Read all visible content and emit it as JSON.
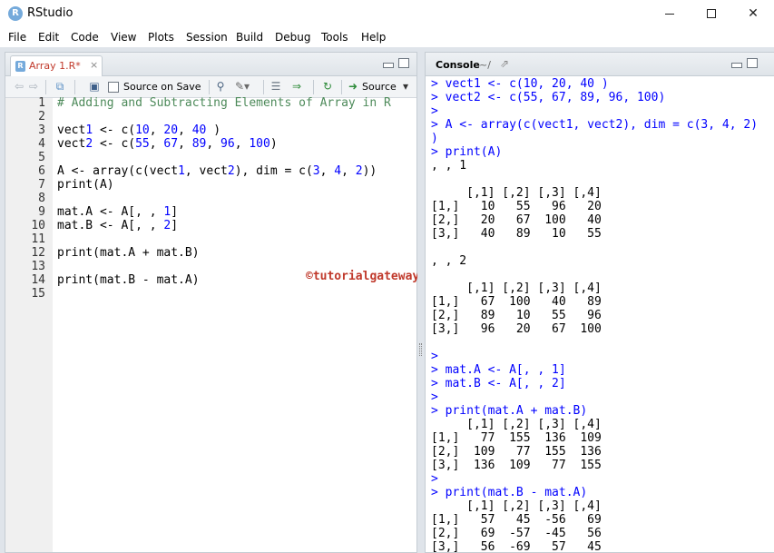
{
  "window": {
    "logo": "R",
    "title": "RStudio",
    "minimize": "",
    "maximize": "",
    "close": "✕"
  },
  "menu": [
    "File",
    "Edit",
    "Code",
    "View",
    "Plots",
    "Session",
    "Build",
    "Debug",
    "Tools",
    "Help"
  ],
  "editor": {
    "tab_label": "Array 1.R*",
    "tab_close": "×",
    "source_on_save": "Source on Save",
    "source_button": "Source",
    "icons": [
      "back-arrow-icon",
      "forward-arrow-icon",
      "show-in-window-icon",
      "save-icon",
      "search-icon",
      "code-tools-wand-icon",
      "compile-report-icon",
      "run-line-icon",
      "rerun-icon",
      "source-icon"
    ],
    "line_numbers": [
      "1",
      "2",
      "3",
      "4",
      "5",
      "6",
      "7",
      "8",
      "9",
      "10",
      "11",
      "12",
      "13",
      "14",
      "15"
    ],
    "lines": [
      "# Adding and Subtracting Elements of Array in R",
      "",
      "vect1 <- c(10, 20, 40 )",
      "vect2 <- c(55, 67, 89, 96, 100)",
      "",
      "A <- array(c(vect1, vect2), dim = c(3, 4, 2))",
      "print(A)",
      "",
      "mat.A <- A[, , 1]",
      "mat.B <- A[, , 2]",
      "",
      "print(mat.A + mat.B)",
      "",
      "print(mat.B - mat.A)",
      ""
    ],
    "watermark": "©tutorialgateway.org"
  },
  "console": {
    "tab_label": "Console",
    "path": "~/",
    "lines": [
      {
        "kind": "in",
        "text": "> vect1 <- c(10, 20, 40 )"
      },
      {
        "kind": "in",
        "text": "> vect2 <- c(55, 67, 89, 96, 100)"
      },
      {
        "kind": "in",
        "text": ">"
      },
      {
        "kind": "in",
        "text": "> A <- array(c(vect1, vect2), dim = c(3, 4, 2)"
      },
      {
        "kind": "in",
        "text": ")"
      },
      {
        "kind": "in",
        "text": "> print(A)"
      },
      {
        "kind": "out",
        "text": ", , 1"
      },
      {
        "kind": "out",
        "text": ""
      },
      {
        "kind": "out",
        "text": "     [,1] [,2] [,3] [,4]"
      },
      {
        "kind": "out",
        "text": "[1,]   10   55   96   20"
      },
      {
        "kind": "out",
        "text": "[2,]   20   67  100   40"
      },
      {
        "kind": "out",
        "text": "[3,]   40   89   10   55"
      },
      {
        "kind": "out",
        "text": ""
      },
      {
        "kind": "out",
        "text": ", , 2"
      },
      {
        "kind": "out",
        "text": ""
      },
      {
        "kind": "out",
        "text": "     [,1] [,2] [,3] [,4]"
      },
      {
        "kind": "out",
        "text": "[1,]   67  100   40   89"
      },
      {
        "kind": "out",
        "text": "[2,]   89   10   55   96"
      },
      {
        "kind": "out",
        "text": "[3,]   96   20   67  100"
      },
      {
        "kind": "out",
        "text": ""
      },
      {
        "kind": "in",
        "text": ">"
      },
      {
        "kind": "in",
        "text": "> mat.A <- A[, , 1]"
      },
      {
        "kind": "in",
        "text": "> mat.B <- A[, , 2]"
      },
      {
        "kind": "in",
        "text": ">"
      },
      {
        "kind": "in",
        "text": "> print(mat.A + mat.B)"
      },
      {
        "kind": "out",
        "text": "     [,1] [,2] [,3] [,4]"
      },
      {
        "kind": "out",
        "text": "[1,]   77  155  136  109"
      },
      {
        "kind": "out",
        "text": "[2,]  109   77  155  136"
      },
      {
        "kind": "out",
        "text": "[3,]  136  109   77  155"
      },
      {
        "kind": "in",
        "text": ">"
      },
      {
        "kind": "in",
        "text": "> print(mat.B - mat.A)"
      },
      {
        "kind": "out",
        "text": "     [,1] [,2] [,3] [,4]"
      },
      {
        "kind": "out",
        "text": "[1,]   57   45  -56   69"
      },
      {
        "kind": "out",
        "text": "[2,]   69  -57  -45   56"
      },
      {
        "kind": "out",
        "text": "[3,]   56  -69   57   45"
      }
    ]
  },
  "colors": {
    "console_input": "#0000ff",
    "console_output": "#000000",
    "comment": "#4d8a5a",
    "number": "#0000ff",
    "watermark": "#c0392b"
  }
}
